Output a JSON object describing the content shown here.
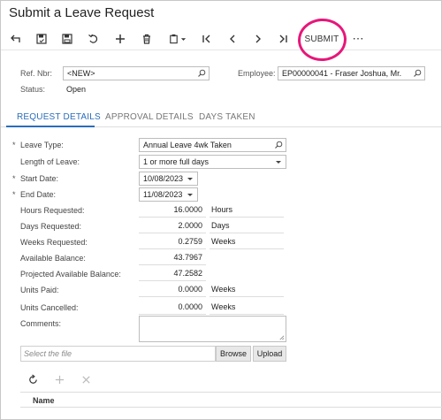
{
  "title": "Submit a Leave Request",
  "toolbar": {
    "submit_label": "SUBMIT",
    "more_label": "⋯",
    "highlight_color": "#e6177a"
  },
  "header": {
    "ref_label": "Ref. Nbr:",
    "ref_value": "<NEW>",
    "status_label": "Status:",
    "status_value": "Open",
    "employee_label": "Employee:",
    "employee_value": "EP00000041 - Fraser Joshua, Mr."
  },
  "tabs": {
    "request_details": "REQUEST DETAILS",
    "approval_details": "APPROVAL DETAILS",
    "days_taken": "DAYS TAKEN",
    "accent_color": "#2a6ebb"
  },
  "form": {
    "required_mark": "*",
    "leave_type_label": "Leave Type:",
    "leave_type_value": "Annual Leave 4wk Taken",
    "length_label": "Length of Leave:",
    "length_value": "1 or more full days",
    "start_label": "Start Date:",
    "start_value": "10/08/2023",
    "end_label": "End Date:",
    "end_value": "11/08/2023",
    "hours_label": "Hours Requested:",
    "hours_value": "16.0000",
    "hours_unit": "Hours",
    "days_label": "Days Requested:",
    "days_value": "2.0000",
    "days_unit": "Days",
    "weeks_label": "Weeks Requested:",
    "weeks_value": "0.2759",
    "weeks_unit": "Weeks",
    "avail_label": "Available Balance:",
    "avail_value": "43.7967",
    "proj_label": "Projected Available Balance:",
    "proj_value": "47.2582",
    "paid_label": "Units Paid:",
    "paid_value": "0.0000",
    "paid_unit": "Weeks",
    "cancel_label": "Units Cancelled:",
    "cancel_value": "0.0000",
    "cancel_unit": "Weeks",
    "comments_label": "Comments:"
  },
  "files": {
    "placeholder": "Select the file",
    "browse_label": "Browse",
    "upload_label": "Upload"
  },
  "grid": {
    "name_header": "Name"
  }
}
